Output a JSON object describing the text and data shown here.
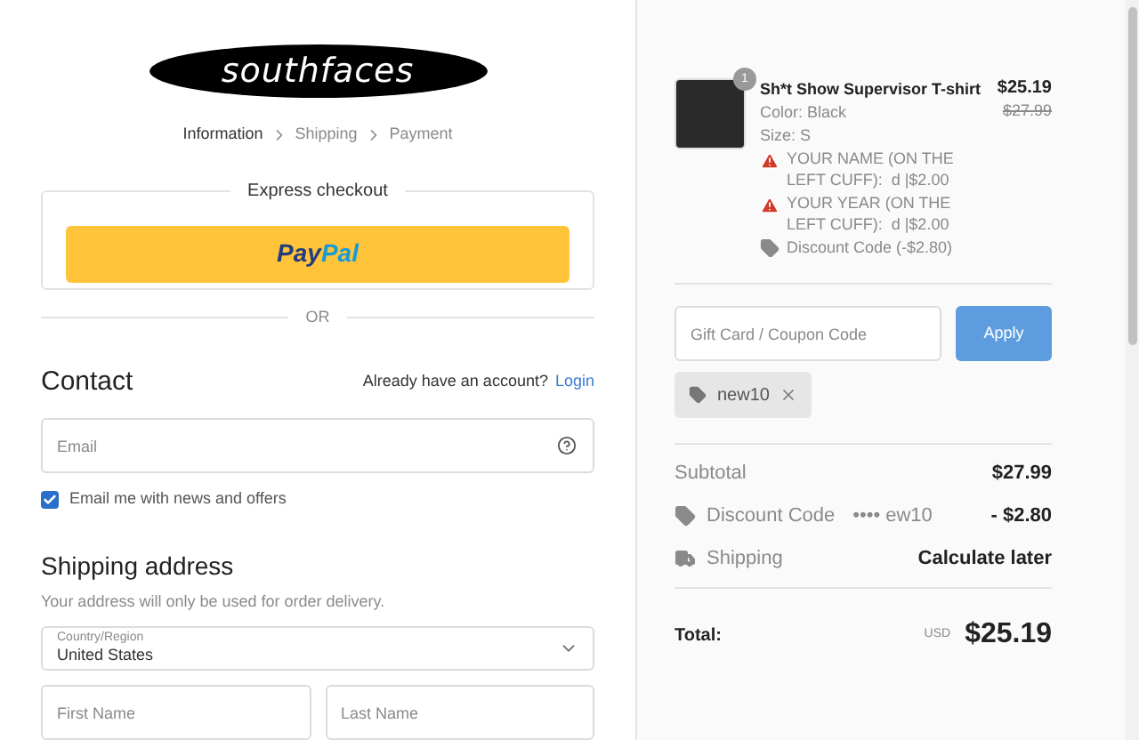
{
  "logo": {
    "text": "southfaces"
  },
  "breadcrumb": [
    {
      "label": "Information",
      "selected": true
    },
    {
      "label": "Shipping",
      "selected": false
    },
    {
      "label": "Payment",
      "selected": false
    }
  ],
  "express": {
    "title": "Express checkout",
    "paypal": [
      "Pay",
      "Pal"
    ]
  },
  "divider_label": "OR",
  "contact": {
    "heading": "Contact",
    "account_prompt": "Already have an account?",
    "login_link": "Login",
    "email": {
      "placeholder": "Email"
    },
    "newsletter": {
      "label": "Email me with news and offers",
      "checked": true
    }
  },
  "shipping_address": {
    "heading": "Shipping address",
    "note": "Your address will only be used for order delivery.",
    "country": {
      "label": "Country/Region",
      "value": "United States"
    },
    "first_name": {
      "placeholder": "First Name"
    },
    "last_name": {
      "placeholder": "Last Name"
    }
  },
  "order": {
    "item": {
      "quantity": "1",
      "name": "Sh*t Show Supervisor T-shirt",
      "price": "$25.19",
      "original_price": "$27.99",
      "details": [
        {
          "kind": "plain",
          "text": "Color: Black"
        },
        {
          "kind": "plain",
          "text": "Size: S"
        },
        {
          "kind": "warning",
          "text": "YOUR NAME (ON THE LEFT CUFF):  d |$2.00"
        },
        {
          "kind": "warning",
          "text": "YOUR YEAR (ON THE LEFT CUFF):  d |$2.00"
        },
        {
          "kind": "discount",
          "text": "Discount Code (-$2.80)"
        }
      ]
    },
    "coupon": {
      "placeholder": "Gift Card / Coupon Code",
      "button": "Apply"
    },
    "applied_codes": [
      {
        "code": "new10"
      }
    ],
    "summary": [
      {
        "kind": "subtotal",
        "label": "Subtotal",
        "value": "$27.99"
      },
      {
        "kind": "discount",
        "label": "Discount Code",
        "extra": "•••• ew10",
        "value": "- $2.80"
      },
      {
        "kind": "shipping",
        "label": "Shipping",
        "value": "Calculate later"
      }
    ],
    "total": {
      "label": "Total:",
      "currency": "USD",
      "amount": "$25.19"
    }
  }
}
